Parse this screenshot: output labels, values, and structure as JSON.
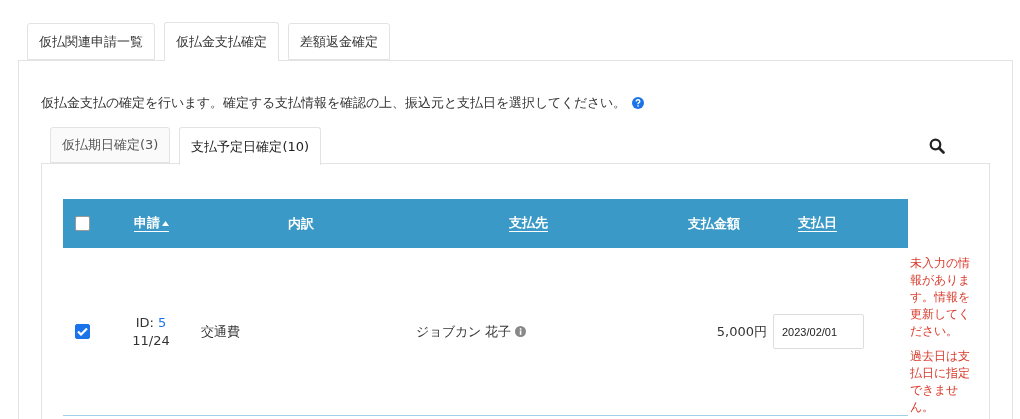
{
  "tabs": [
    {
      "label": "仮払関連申請一覧",
      "selected": false
    },
    {
      "label": "仮払金支払確定",
      "selected": true
    },
    {
      "label": "差額返金確定",
      "selected": false
    }
  ],
  "description": "仮払金支払の確定を行います。確定する支払情報を確認の上、振込元と支払日を選択してください。",
  "sub_tabs": [
    {
      "label": "仮払期日確定(3)",
      "selected": false
    },
    {
      "label": "支払予定日確定(10)",
      "selected": true
    }
  ],
  "table": {
    "select_all": {
      "checked": false
    },
    "columns": [
      {
        "label": "申請",
        "sortable": true,
        "sorted_ascending": true
      },
      {
        "label": "内訳",
        "sortable": false
      },
      {
        "label": "支払先",
        "sortable": true
      },
      {
        "label": "支払金額",
        "sortable": false
      },
      {
        "label": "支払日",
        "sortable": true
      }
    ],
    "rows": [
      {
        "checked": true,
        "id_label": "ID:",
        "id": "5",
        "date": "11/24",
        "breakdown": "交通費",
        "payee": "ジョブカン 花子",
        "amount": "5,000円",
        "payment_date": "2023/02/01",
        "errors": [
          "未入力の情報があります。情報を更新してください。",
          "過去日は支払日に指定できません。"
        ]
      }
    ]
  }
}
